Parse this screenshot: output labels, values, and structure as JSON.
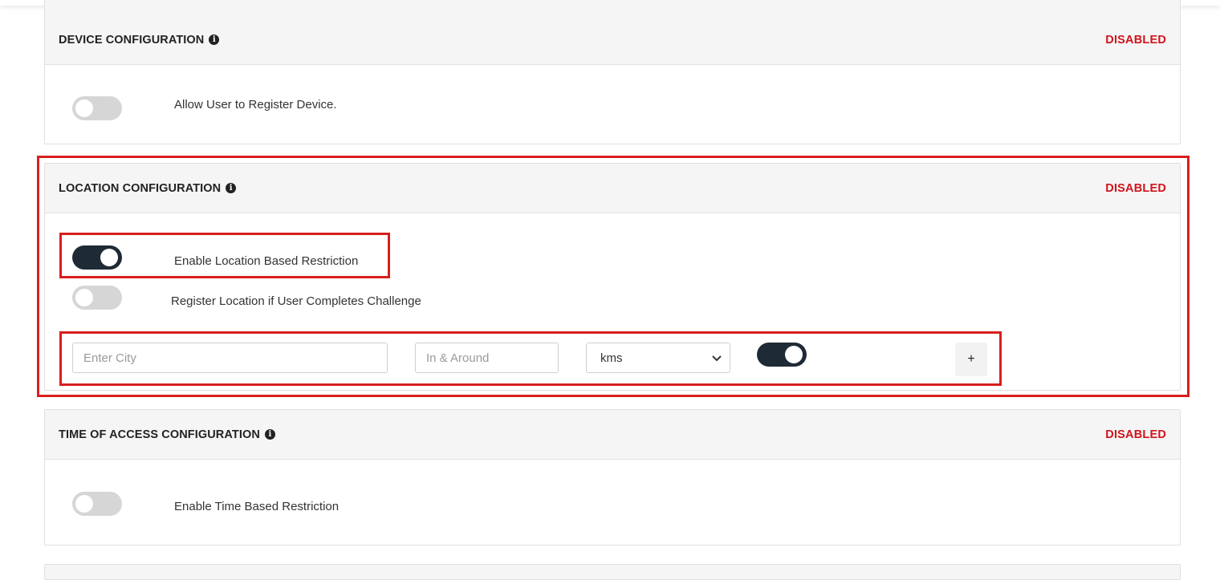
{
  "sections": {
    "device": {
      "title": "DEVICE CONFIGURATION",
      "status": "DISABLED",
      "toggle_label": "Allow User to Register Device.",
      "toggle_on": false
    },
    "location": {
      "title": "LOCATION CONFIGURATION",
      "status": "DISABLED",
      "rows": [
        {
          "label": "Enable Location Based Restriction",
          "on": true
        },
        {
          "label": "Register Location if User Completes Challenge",
          "on": false
        }
      ],
      "city_placeholder": "Enter City",
      "radius_placeholder": "In & Around",
      "unit_selected": "kms",
      "row_toggle_on": true,
      "add_label": "+"
    },
    "time": {
      "title": "TIME OF ACCESS CONFIGURATION",
      "status": "DISABLED",
      "toggle_label": "Enable Time Based Restriction",
      "toggle_on": false
    }
  },
  "icons": {
    "info": "info-icon",
    "select_arrow": "chevron-down-icon"
  },
  "colors": {
    "status_disabled": "#d0141c",
    "toggle_on": "#1e2a35",
    "toggle_off": "#d6d6d6",
    "highlight": "#d81e1e"
  }
}
